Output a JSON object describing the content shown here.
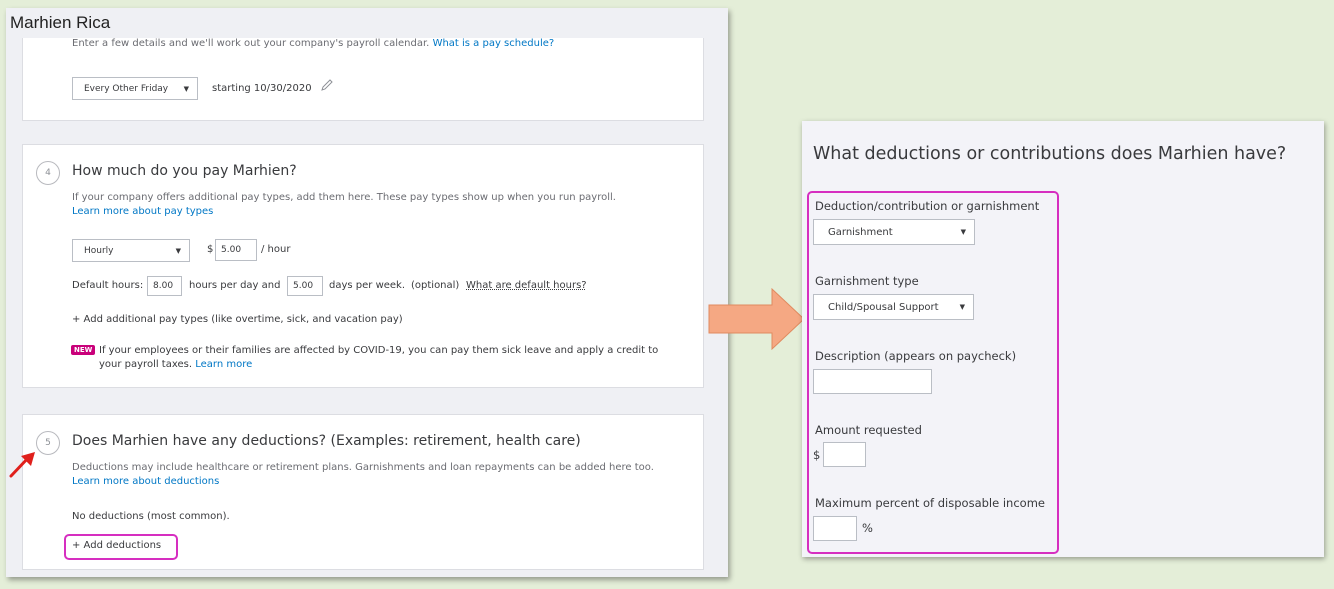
{
  "window_title": "Marhien Rica",
  "schedule": {
    "intro": "Enter a few details and we'll work out your company's payroll calendar.",
    "intro_link": "What is a pay schedule?",
    "frequency": "Every Other Friday",
    "starting": "starting 10/30/2020"
  },
  "pay": {
    "step": "4",
    "heading": "How much do you pay Marhien?",
    "desc": "If your company offers additional pay types, add them here. These pay types show up when you run payroll.",
    "learn_link": "Learn more about pay types",
    "pay_type": "Hourly",
    "currency": "$",
    "rate": "5.00",
    "rate_unit": "/ hour",
    "default_hours_label": "Default hours:",
    "hours_per_day": "8.00",
    "hours_per_day_label": "hours per day and",
    "days_per_week": "5.00",
    "days_per_week_label": "days per week.",
    "optional": "(optional)",
    "default_hours_link": "What are default hours?",
    "add_pay_types": "+ Add additional pay types (like overtime, sick, and vacation pay)",
    "new_badge": "NEW",
    "covid_line1": "If your employees or their families are affected by COVID-19, you can pay them sick leave and apply a credit to",
    "covid_line2": "your payroll taxes.",
    "covid_link": "Learn more"
  },
  "deductions": {
    "step": "5",
    "heading": "Does Marhien have any deductions? (Examples: retirement, health care)",
    "desc": "Deductions may include healthcare or retirement plans. Garnishments and loan repayments can be added here too.",
    "learn_link": "Learn more about deductions",
    "none_text": "No deductions (most common).",
    "add_button": "+ Add deductions"
  },
  "detail": {
    "title": "What deductions or contributions does Marhien have?",
    "type_label": "Deduction/contribution or garnishment",
    "type_value": "Garnishment",
    "garn_label": "Garnishment type",
    "garn_value": "Child/Spousal Support",
    "desc_label": "Description (appears on paycheck)",
    "desc_value": "",
    "amount_label": "Amount requested",
    "amount_currency": "$",
    "amount_value": "",
    "max_label": "Maximum percent of disposable income",
    "max_value": "",
    "max_unit": "%"
  },
  "colors": {
    "highlight": "#d62ec0",
    "arrow": "#f5a883",
    "pointer": "#e0201c",
    "link": "#0077c5"
  }
}
